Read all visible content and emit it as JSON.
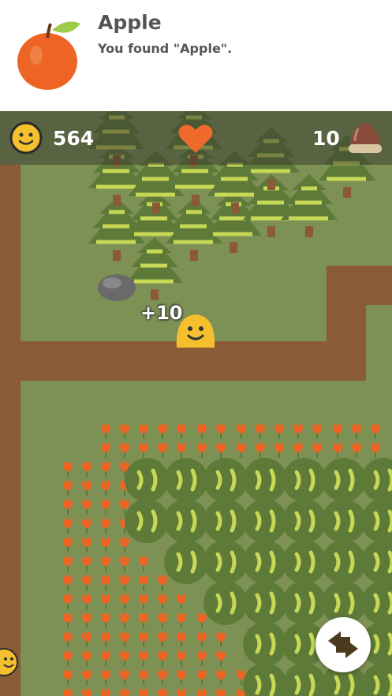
{
  "notification": {
    "title": "Apple",
    "message": "You found \"Apple\"."
  },
  "hud": {
    "coins": "564",
    "nuts": "10"
  },
  "popup": {
    "reward": "+10"
  },
  "colors": {
    "grass": "#7d9154",
    "path": "#8b5a36",
    "tree_dark": "#5e7a39",
    "tree_light": "#c7d857",
    "coin": "#f5c02d",
    "heart": "#f0692c"
  }
}
